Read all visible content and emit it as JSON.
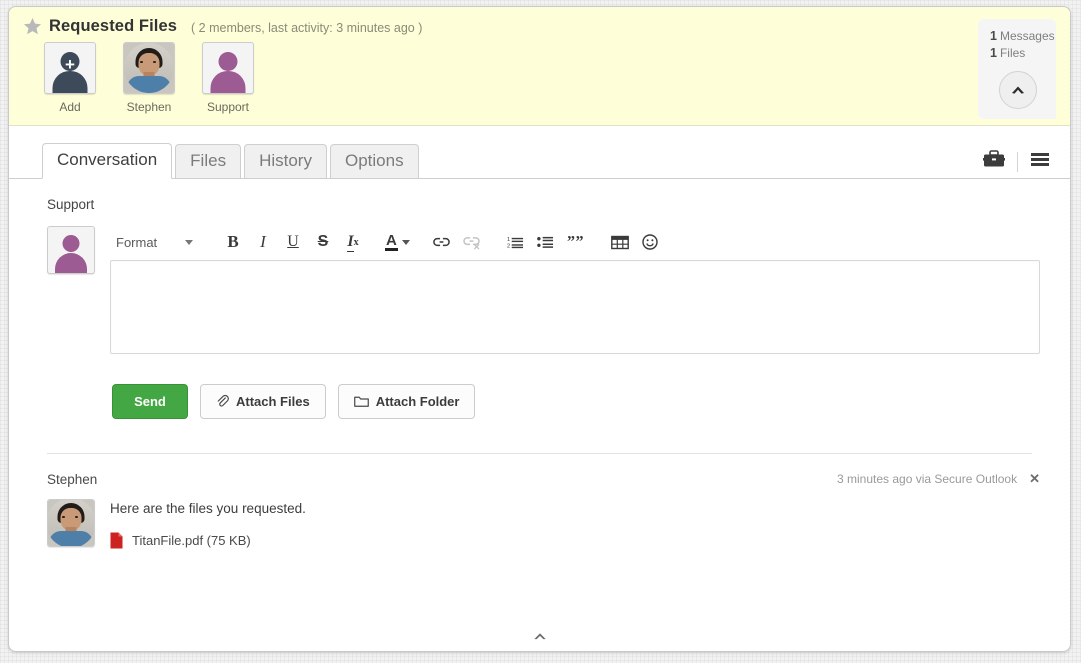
{
  "header": {
    "star_icon": "star-icon",
    "title": "Requested Files",
    "meta": "( 2 members, last activity: 3 minutes ago )",
    "members": [
      {
        "name": "Add",
        "avatar": "add-member-silhouette"
      },
      {
        "name": "Stephen",
        "avatar": "stephen-photo"
      },
      {
        "name": "Support",
        "avatar": "support-silhouette"
      }
    ],
    "counts": {
      "messages_num": "1",
      "messages_label": "Messages",
      "files_num": "1",
      "files_label": "Files",
      "collapse_icon": "chevron-up-icon"
    }
  },
  "tabs": [
    {
      "label": "Conversation",
      "active": true
    },
    {
      "label": "Files",
      "active": false
    },
    {
      "label": "History",
      "active": false
    },
    {
      "label": "Options",
      "active": false
    }
  ],
  "tab_tools": [
    {
      "icon": "briefcase-icon"
    },
    {
      "icon": "hamburger-menu-icon"
    }
  ],
  "composer": {
    "recipient_label": "Support",
    "avatar": "support-silhouette",
    "toolbar": {
      "format_label": "Format",
      "format_caret": "chevron-down-icon",
      "bold": "B",
      "italic": "I",
      "underline": "U",
      "strikethrough": "S",
      "remove_format": "Tx",
      "text_color": "A",
      "link": "link-icon",
      "unlink": "unlink-icon",
      "numbered_list": "numbered-list-icon",
      "bullet_list": "bullet-list-icon",
      "blockquote": "blockquote-icon",
      "table": "table-icon",
      "emoji": "emoji-icon"
    },
    "editor_value": "",
    "editor_placeholder": "",
    "buttons": {
      "send": "Send",
      "attach_files": "Attach Files",
      "attach_files_icon": "paperclip-icon",
      "attach_folder": "Attach Folder",
      "attach_folder_icon": "folder-icon"
    }
  },
  "message": {
    "author": "Stephen",
    "meta": "3 minutes ago via Secure Outlook",
    "close_icon": "close-icon",
    "avatar": "stephen-photo",
    "text": "Here are the files you requested.",
    "attachment": {
      "icon": "pdf-file-icon",
      "name": "TitanFile.pdf (75 KB)"
    }
  },
  "footer": {
    "collapse_icon": "chevron-up-icon"
  },
  "colors": {
    "header_background": "#feffd9",
    "send_button": "#43a843",
    "pdf_icon": "#cc2222",
    "support_avatar": "#9c5b92",
    "add_avatar": "#3c4a5a"
  }
}
